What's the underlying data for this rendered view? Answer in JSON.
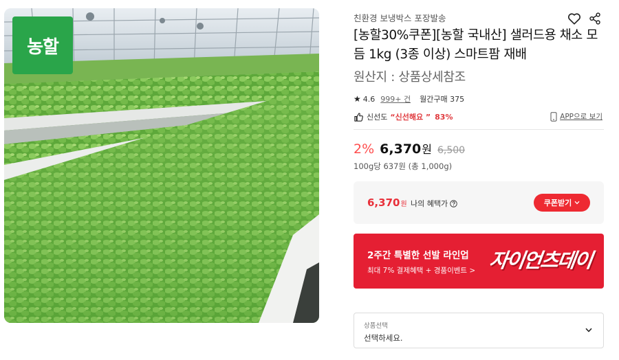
{
  "product_image": {
    "brand_badge_text": "농할",
    "brand_color": "#2aa54a"
  },
  "seller": {
    "name": "친환경 보냉박스 포장발송",
    "icons": [
      "heart-icon",
      "share-icon"
    ]
  },
  "product": {
    "title": "[농할30%쿠폰][농할 국내산] 샐러드용 채소 모듬 1kg (3종 이상) 스마트팜 재배",
    "origin": "원산지 : 상품상세참조"
  },
  "rating": {
    "score": "4.6",
    "reviews": "999+ 건",
    "monthly_sales": "월간구매 375"
  },
  "freshness": {
    "label": "신선도",
    "value": "“신선해요 ”",
    "percent": "83%",
    "app_view_label": "APP으로 보기"
  },
  "price": {
    "discount": "2%",
    "sale_price": "6,370",
    "currency": "원",
    "original_price": "6,500",
    "unit_price": "100g당 637원 (총 1,000g)"
  },
  "benefit": {
    "price": "6,370",
    "currency": "원",
    "label": "나의 혜택가",
    "coupon_button": "쿠폰받기"
  },
  "promo": {
    "title": "2주간 특별한 선발 라인업",
    "subtitle": "최대 7% 결제혜택 + 경품이벤트 >",
    "logo_text": "자이언츠데이",
    "color": "#e51f33"
  },
  "option": {
    "label": "상품선택",
    "placeholder": "선택하세요."
  },
  "colors": {
    "accent_red": "#e8303a",
    "discount_red": "#ff4d4d"
  }
}
